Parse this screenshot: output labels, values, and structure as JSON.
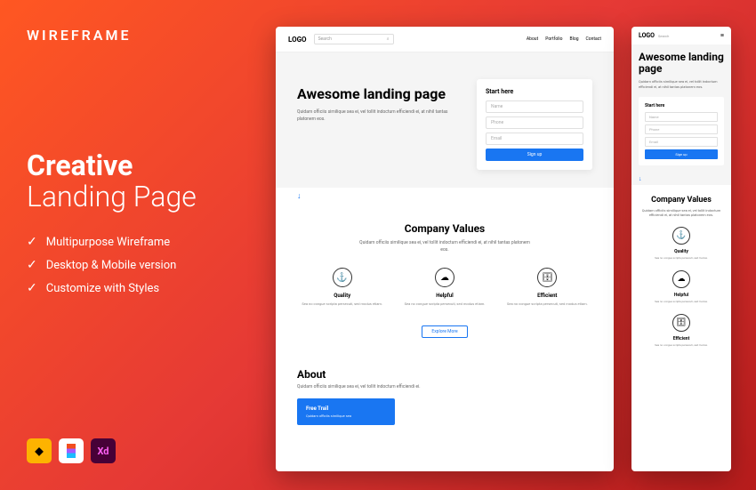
{
  "brand": "WIREFRAME",
  "headline": {
    "bold": "Creative",
    "light": "Landing Page"
  },
  "features": [
    "Multipurpose Wireframe",
    "Desktop & Mobile version",
    "Customize with Styles"
  ],
  "tools": {
    "xd": "Xd"
  },
  "desktop": {
    "logo": "LOGO",
    "search": {
      "placeholder": "Search",
      "icon": "⌕"
    },
    "nav": [
      "About",
      "Portfolio",
      "Blog",
      "Contact"
    ],
    "hero": {
      "title": "Awesome landing page",
      "text": "Quidam officiis similique sea ei, vel tollit indoctum efficiendi ei, at nihil tantas platonem eos."
    },
    "form": {
      "title": "Start here",
      "fields": [
        "Name",
        "Phone",
        "Email"
      ],
      "button": "Sign up"
    },
    "scroll": "↓",
    "values": {
      "title": "Company Values",
      "sub": "Quidam officiis similique sea ei, vel tollit indoctum efficiendi ei, at nihil tantas platonem eos.",
      "cols": [
        {
          "icon": "⚓",
          "title": "Quality",
          "text": "Sea no congue scripta persecuti, sed modus etiam."
        },
        {
          "icon": "☁",
          "title": "Helpful",
          "text": "Sea no congue scripta persecuti, sed modus etiam."
        },
        {
          "icon": "🗄",
          "title": "Efficient",
          "text": "Sea no congue scripta persecuti, sed modus etiam."
        }
      ],
      "button": "Explore More"
    },
    "about": {
      "title": "About",
      "text": "Quidam officiis similique sea ei, vel tollit indoctum efficiendi ei.",
      "trail": {
        "title": "Free Trail",
        "text": "Quidam officiis similique sea"
      }
    }
  },
  "mobile": {
    "logo": "LOGO",
    "search": "Search",
    "burger": "≡",
    "hero": {
      "title": "Awesome landing page",
      "text": "Quidam officiis similique sea ei, vel tollit indoctum efficiendi ei, at nihil tantas platonem eos."
    },
    "form": {
      "title": "Start here",
      "fields": [
        "Name",
        "Phone",
        "Email"
      ],
      "button": "Sign up"
    },
    "scroll": "↓",
    "values": {
      "title": "Company Values",
      "sub": "Quidam officiis similique sea ei, vel tollit indoctum efficiendi ei, at nihil tantas platonem eos.",
      "cols": [
        {
          "icon": "⚓",
          "title": "Quality",
          "text": "Sea no congue scripta persecuti, sed modus."
        },
        {
          "icon": "☁",
          "title": "Helpful",
          "text": "Sea no congue scripta persecuti, sed modus."
        },
        {
          "icon": "🗄",
          "title": "Efficient",
          "text": "Sea no congue scripta persecuti, sed modus."
        }
      ]
    }
  }
}
